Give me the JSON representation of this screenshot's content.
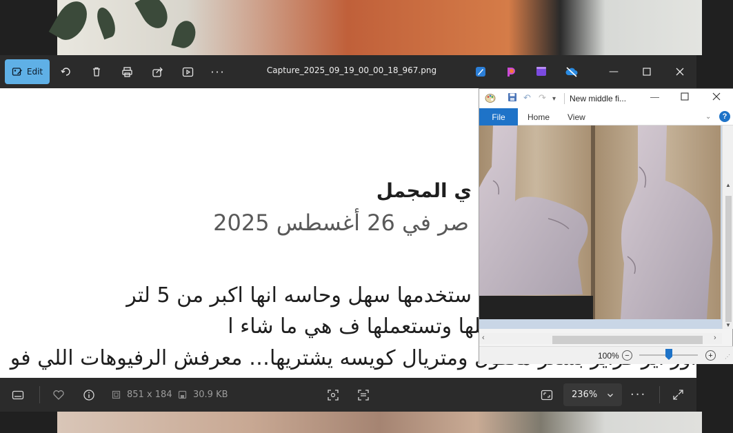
{
  "viewer": {
    "edit_label": "Edit",
    "file_name": "Capture_2025_09_19_00_00_18_967.png",
    "dimensions": "851 x 184",
    "file_size": "30.9 KB",
    "zoom": "236%"
  },
  "document": {
    "heading": "ي المجمل",
    "date_line": "صر في 26 أغسطس 2025",
    "line1": "ستخدمها سهل وحاسه انها اكبر من 5 لتر",
    "line2": "لوج لكن سهل تعرف تشغلها وتستعملها ف هي ما شاء ا",
    "line3": "اور اير فراير بسعر معقول ومتريال كويسه يشتريها… معرفش الرفيوهات اللي فو"
  },
  "paint": {
    "title": "New middle fi...",
    "tabs": {
      "file": "File",
      "home": "Home",
      "view": "View"
    },
    "help": "?",
    "zoom": "100%"
  },
  "colors": {
    "accent": "#5fb0e6",
    "paint_file": "#1e73c8",
    "toolbar": "#2b2b2b"
  }
}
